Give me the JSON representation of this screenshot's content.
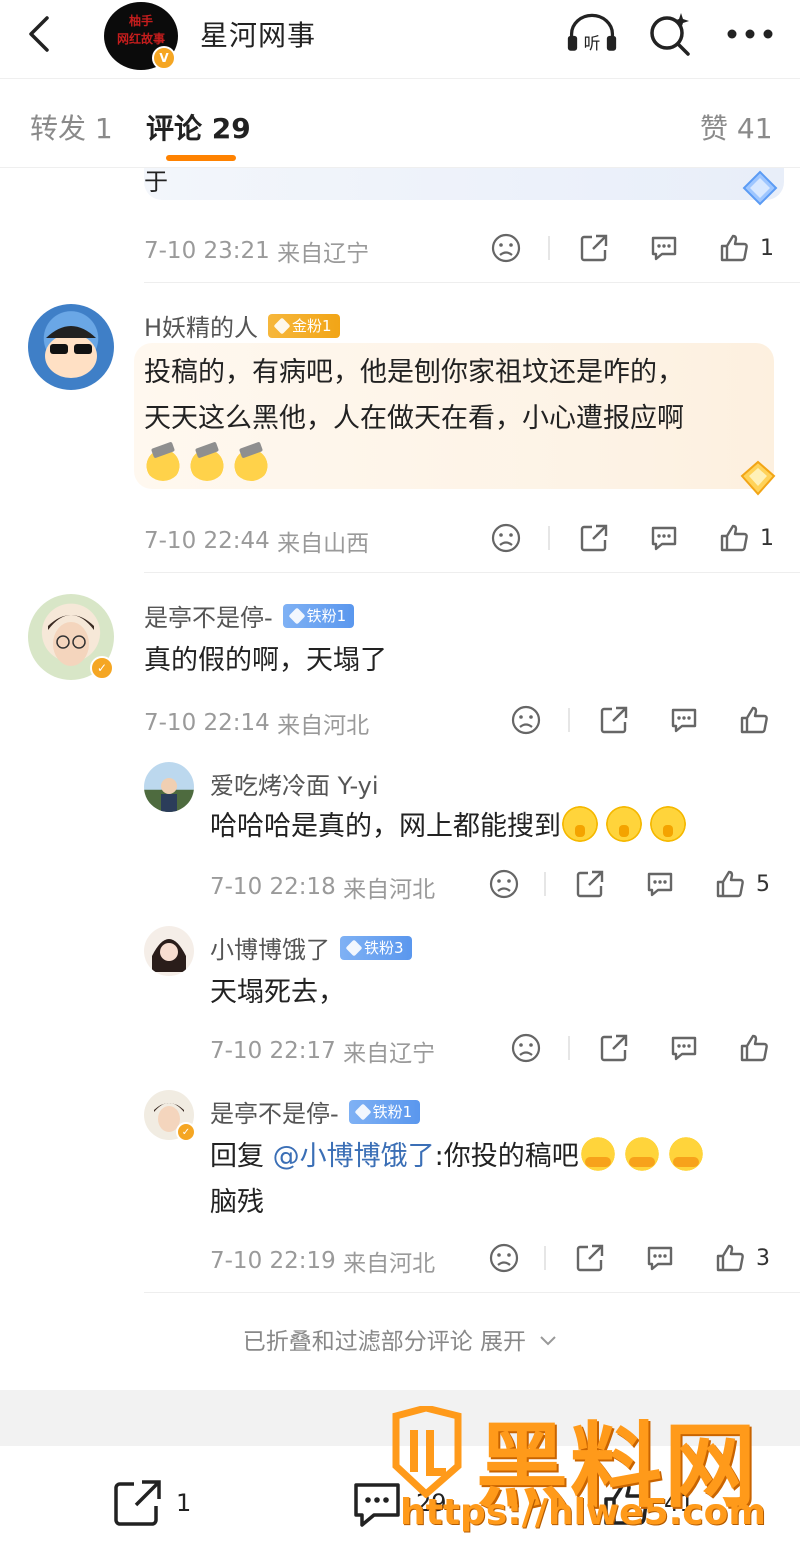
{
  "header": {
    "account_name": "星河网事",
    "avatar_text_line1": "柚手",
    "avatar_text_line2": "网红故事",
    "verified_mark": "V",
    "icons": [
      "back-arrow-icon",
      "listen-headphones-icon",
      "search-sparkle-icon",
      "more-dots-icon"
    ],
    "listen_label": "听"
  },
  "tabs": {
    "repost": "转发 1",
    "comments": "评论 29",
    "likes": "赞 41",
    "accent": "#ff8200"
  },
  "comments": [
    {
      "partial_text": "于",
      "time": "7-10 23:21",
      "location": "来自辽宁",
      "likes": "1"
    },
    {
      "user": "H妖精的人",
      "badge": "金粉1",
      "line1": "投稿的，有病吧，他是刨你家祖坟还是咋的，",
      "line2": "天天这么黑他，人在做天在看，小心遭报应啊",
      "time": "7-10 22:44",
      "location": "来自山西",
      "likes": "1"
    },
    {
      "user": "是亭不是停-",
      "badge": "铁粉1",
      "text": "真的假的啊，天塌了",
      "time": "7-10 22:14",
      "location": "来自河北",
      "likes": "",
      "replies": [
        {
          "user": "爱吃烤冷面 Y-yi",
          "text": "哈哈哈是真的，网上都能搜到",
          "time": "7-10 22:18",
          "location": "来自河北",
          "likes": "5"
        },
        {
          "user": "小博博饿了",
          "badge": "铁粉3",
          "text": "天塌死去，",
          "time": "7-10 22:17",
          "location": "来自辽宁",
          "likes": ""
        },
        {
          "user": "是亭不是停-",
          "badge": "铁粉1",
          "reply_prefix": "回复 ",
          "mention": "@小博博饿了",
          "text": ":你投的稿吧",
          "text_line2": "脑残",
          "time": "7-10 22:19",
          "location": "来自河北",
          "likes": "3"
        }
      ]
    }
  ],
  "collapsed_text": "已折叠和过滤部分评论 展开",
  "bottom_bar": {
    "repost_count": "1",
    "comment_count": "29",
    "like_count": "41"
  },
  "watermark": {
    "title": "黑料网",
    "url": "https://hlwe5.com"
  }
}
